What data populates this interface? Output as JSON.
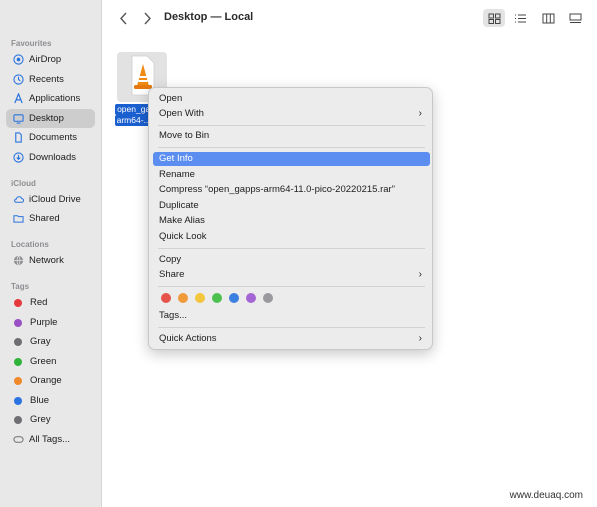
{
  "window": {
    "title": "Desktop — Local"
  },
  "sidebar": {
    "favourites_heading": "Favourites",
    "favourites": [
      {
        "label": "AirDrop",
        "icon": "airdrop-icon"
      },
      {
        "label": "Recents",
        "icon": "clock-icon"
      },
      {
        "label": "Applications",
        "icon": "applications-icon"
      },
      {
        "label": "Desktop",
        "icon": "desktop-icon",
        "selected": true
      },
      {
        "label": "Documents",
        "icon": "document-icon"
      },
      {
        "label": "Downloads",
        "icon": "download-icon"
      }
    ],
    "icloud_heading": "iCloud",
    "icloud": [
      {
        "label": "iCloud Drive",
        "icon": "cloud-icon"
      },
      {
        "label": "Shared",
        "icon": "shared-folder-icon"
      }
    ],
    "locations_heading": "Locations",
    "locations": [
      {
        "label": "Network",
        "icon": "globe-icon"
      }
    ],
    "tags_heading": "Tags",
    "tags": [
      {
        "label": "Red",
        "color": "#e5393b"
      },
      {
        "label": "Purple",
        "color": "#9b4fc4"
      },
      {
        "label": "Gray",
        "color": "#6e6e73"
      },
      {
        "label": "Green",
        "color": "#2fb33a"
      },
      {
        "label": "Orange",
        "color": "#f0892b"
      },
      {
        "label": "Blue",
        "color": "#2a73e0"
      },
      {
        "label": "Grey",
        "color": "#6e6e73"
      },
      {
        "label": "All Tags...",
        "icon": "tag-outline-icon"
      }
    ]
  },
  "file": {
    "name_line1": "open_gap",
    "name_line2": "arm64-...0"
  },
  "context_menu": {
    "open": "Open",
    "open_with": "Open With",
    "move_to_bin": "Move to Bin",
    "get_info": "Get Info",
    "rename": "Rename",
    "compress": "Compress “open_gapps-arm64-11.0-pico-20220215.rar”",
    "duplicate": "Duplicate",
    "make_alias": "Make Alias",
    "quick_look": "Quick Look",
    "copy": "Copy",
    "share": "Share",
    "tag_colors": [
      "#e5534b",
      "#f09a3a",
      "#f3c63b",
      "#4cc14f",
      "#3b7fe0",
      "#a466d4",
      "#9a9a9e"
    ],
    "tags": "Tags...",
    "quick_actions": "Quick Actions",
    "highlight_color": "#5b8ef0"
  },
  "watermark": "www.deuaq.com"
}
